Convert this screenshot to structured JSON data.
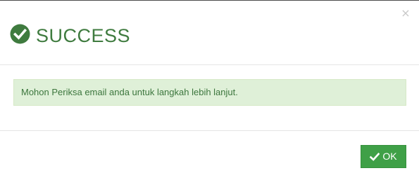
{
  "modal": {
    "close_glyph": "×",
    "title": "SUCCESS",
    "title_icon": "check-circle-icon",
    "message": "Mohon Periksa email anda untuk langkah lebih lanjut.",
    "ok_label": "OK",
    "ok_icon": "check-icon"
  },
  "colors": {
    "success_text": "#3c763d",
    "title_green": "#3f7b3f",
    "alert_background": "#dff0d8",
    "button_green": "#3fa047"
  }
}
